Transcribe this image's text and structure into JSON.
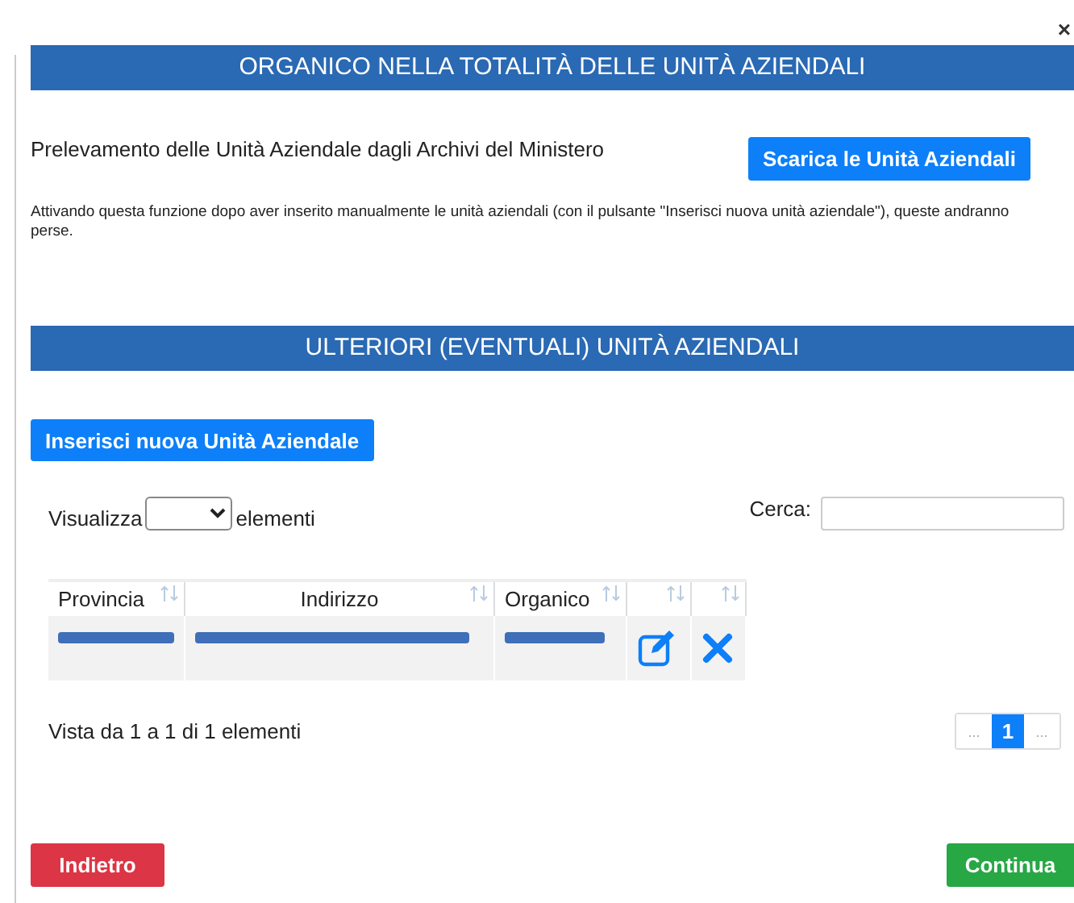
{
  "close_button": {
    "label": "×"
  },
  "section_1": {
    "title": "ORGANICO NELLA TOTALITÀ DELLE UNITÀ AZIENDALI",
    "description": "Prelevamento delle Unità Aziendale dagli Archivi del Ministero",
    "button": "Scarica le Unità Aziendali",
    "note": "Attivando questa funzione dopo aver inserito manualmente le unità aziendali (con il pulsante \"Inserisci nuova unità aziendale\"), queste andranno perse."
  },
  "section_2": {
    "title": "ULTERIORI (EVENTUALI) UNITÀ AZIENDALI",
    "button": "Inserisci nuova Unità Aziendale"
  },
  "table_controls": {
    "show_label": "Visualizza",
    "show_suffix": "elementi",
    "search_label": "Cerca:"
  },
  "table": {
    "columns": [
      {
        "label": "Provincia"
      },
      {
        "label": "Indirizzo"
      },
      {
        "label": "Organico"
      },
      {},
      {}
    ],
    "rows": [
      {
        "redacted": true
      }
    ]
  },
  "table_info": "Vista da 1 a 1 di 1 elementi",
  "pagination": [
    {
      "label": "...",
      "selected": false,
      "disabled": true
    },
    {
      "label": "1",
      "selected": true,
      "disabled": false
    },
    {
      "label": "...",
      "selected": false,
      "disabled": true
    }
  ],
  "footer": {
    "back": "Indietro",
    "next": "Continua"
  }
}
